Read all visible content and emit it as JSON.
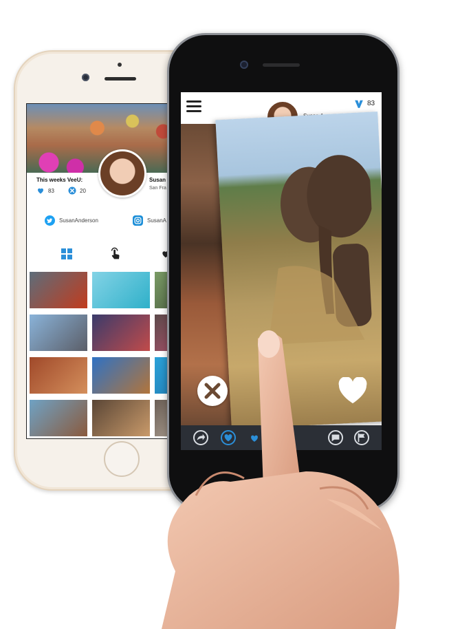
{
  "back_phone": {
    "stats_label": "This weeks VeeU:",
    "likes_count": "83",
    "dislikes_count": "20",
    "user_name": "Susan",
    "user_location": "San Fra",
    "twitter_handle": "SusanAnderson",
    "instagram_handle": "SusanA",
    "photo_grid": [
      {
        "name": "market-photo",
        "c1": "#5d6d7a",
        "c2": "#c23b1d"
      },
      {
        "name": "beach-photo",
        "c1": "#83d3e6",
        "c2": "#2fb0c9"
      },
      {
        "name": "harbor-photo",
        "c1": "#7a9b65",
        "c2": "#3b4a34"
      },
      {
        "name": "city-bridge-photo",
        "c1": "#8ab3d9",
        "c2": "#5b5e68"
      },
      {
        "name": "canal-night-photo",
        "c1": "#3a3b6b",
        "c2": "#c24b4a"
      },
      {
        "name": "flowers-photo",
        "c1": "#5b4a4a",
        "c2": "#d2547b"
      },
      {
        "name": "salad-photo",
        "c1": "#a0492a",
        "c2": "#d48f5c"
      },
      {
        "name": "monument-photo",
        "c1": "#2f72c4",
        "c2": "#b2753b"
      },
      {
        "name": "shark-photo",
        "c1": "#2aa1d8",
        "c2": "#1f6fa6"
      },
      {
        "name": "couple-photo",
        "c1": "#6fa2c4",
        "c2": "#8a5a3d"
      },
      {
        "name": "buffet-photo",
        "c1": "#5a4636",
        "c2": "#c99a6a"
      },
      {
        "name": "people-photo",
        "c1": "#6a5e55",
        "c2": "#d1c2b2"
      }
    ]
  },
  "front_phone": {
    "count": "83",
    "top_name": "Susan A",
    "colors": {
      "accent": "#2b8fd9",
      "bottom_bar": "#2b2f36"
    }
  }
}
